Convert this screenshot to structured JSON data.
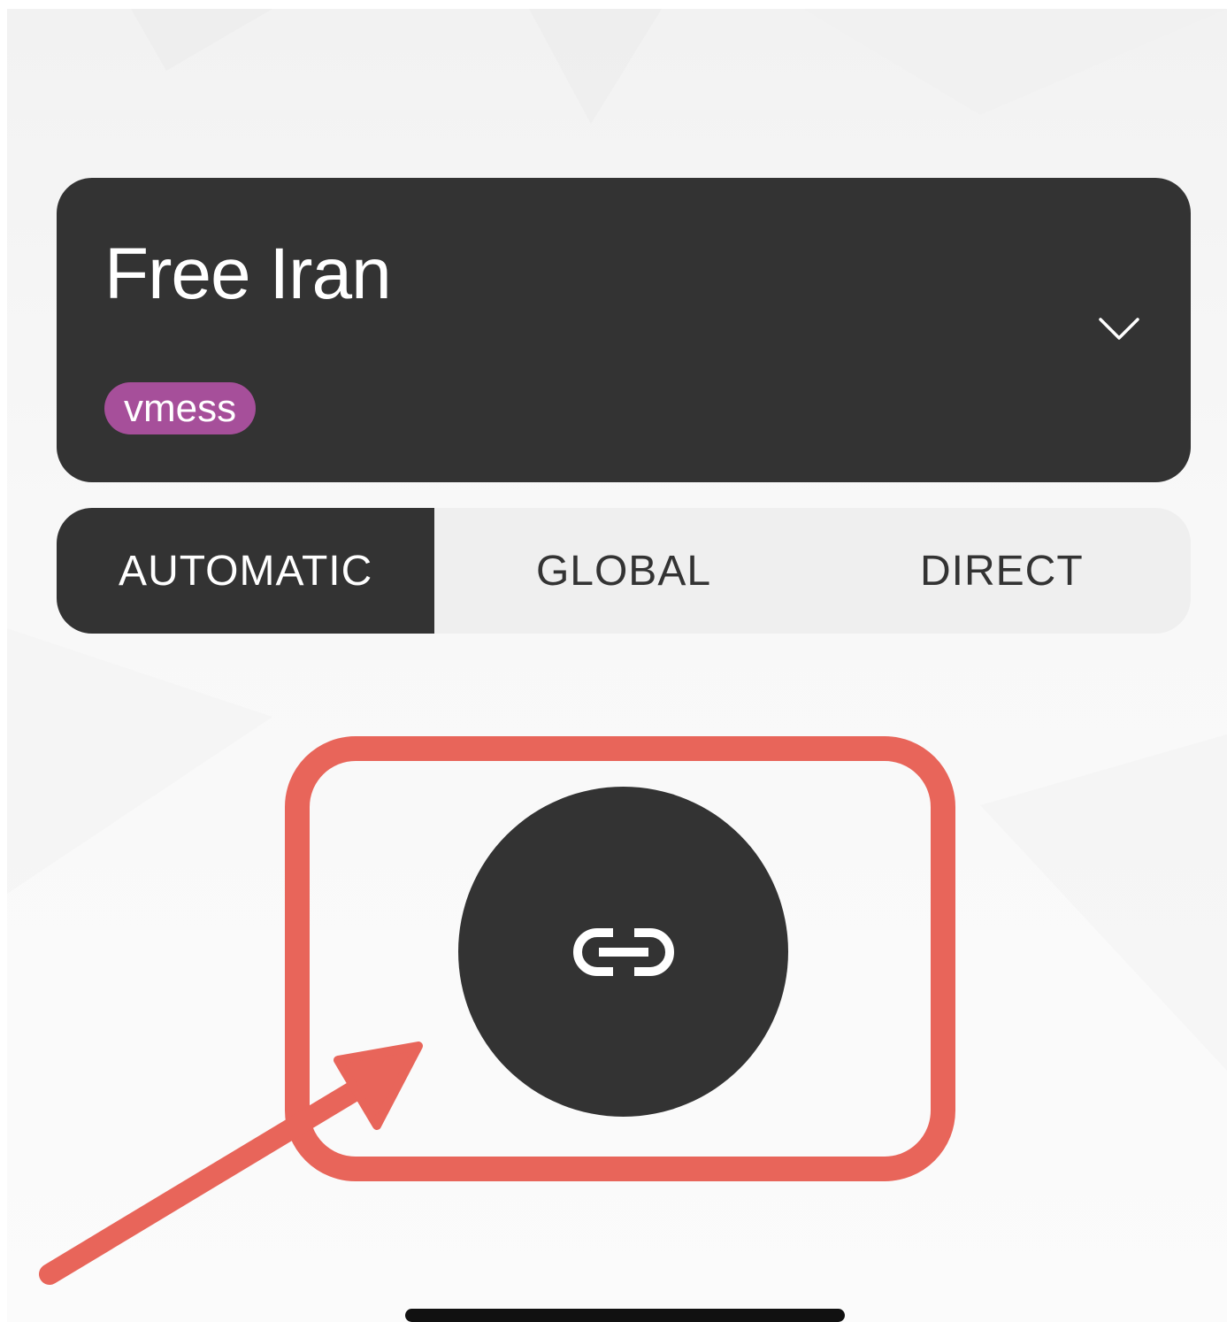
{
  "server": {
    "name": "Free Iran",
    "protocol": "vmess",
    "protocol_color": "#a64f9a",
    "expand_icon": "chevron-down-icon"
  },
  "routing_modes": {
    "selected": "AUTOMATIC",
    "options": [
      "AUTOMATIC",
      "GLOBAL",
      "DIRECT"
    ]
  },
  "connect_button": {
    "icon": "link-icon",
    "state": "disconnected"
  },
  "annotation": {
    "color": "#e8655a",
    "shapes": [
      "highlight-box",
      "pointer-arrow"
    ]
  },
  "colors": {
    "card": "#333333",
    "segment_background": "#efefef",
    "page_background": "#f7f7f7"
  }
}
